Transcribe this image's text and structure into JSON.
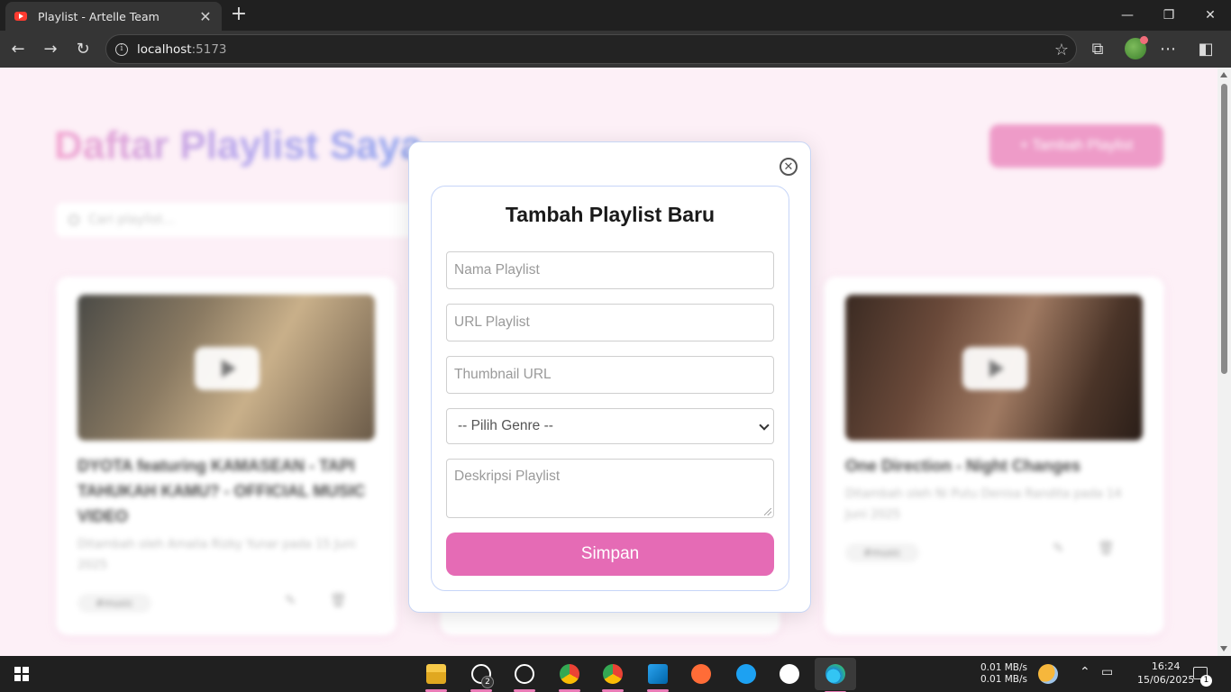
{
  "browser": {
    "tab_title": "Playlist - Artelle Team",
    "url_host": "localhost",
    "url_port": ":5173"
  },
  "page": {
    "title": "Daftar Playlist Saya",
    "add_button": "+ Tambah Playlist",
    "search_placeholder": "Cari playlist...",
    "cards": [
      {
        "title": "DYOTA featuring KAMASEAN - TAPI TAHUKAH KAMU? - OFFICIAL MUSIC VIDEO",
        "meta": "Ditambah oleh Amalia Rizky Yunar pada 15 Juni 2025",
        "tag": "#music"
      },
      {
        "title": "One Direction - Night Changes",
        "meta": "Ditambah oleh Ni Putu Denisa Randita pada 14 Juni 2025",
        "tag": "#music"
      }
    ]
  },
  "modal": {
    "title": "Tambah Playlist Baru",
    "name_placeholder": "Nama Playlist",
    "url_placeholder": "URL Playlist",
    "thumbnail_placeholder": "Thumbnail URL",
    "genre_selected": "-- Pilih Genre --",
    "description_placeholder": "Deskripsi Playlist",
    "submit_label": "Simpan",
    "close_icon": "close-circle-icon"
  },
  "taskbar": {
    "whatsapp_badge": "2",
    "net_up": "0.01 MB/s",
    "net_down": "0.01 MB/s",
    "time": "16:24",
    "date": "15/06/2025",
    "notification_count": "1"
  },
  "colors": {
    "accent_pink": "#e56bb5",
    "page_bg": "#fdf0f7",
    "modal_border": "#c8d6f5"
  }
}
